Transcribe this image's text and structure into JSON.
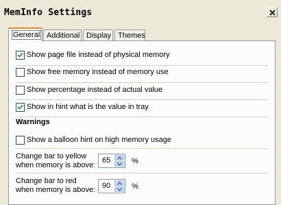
{
  "window": {
    "title": "MemInfo Settings"
  },
  "tabs": [
    {
      "label": "General",
      "active": true
    },
    {
      "label": "Additional",
      "active": false
    },
    {
      "label": "Display",
      "active": false
    },
    {
      "label": "Themes",
      "active": false
    }
  ],
  "options": [
    {
      "label": "Show page file instead of physical memory",
      "checked": true
    },
    {
      "label": "Show free memory instead of memory use",
      "checked": false
    },
    {
      "label": "Show percentage instead of actual value",
      "checked": false
    },
    {
      "label": "Show in hint what is the value in tray",
      "checked": true
    }
  ],
  "warnings": {
    "heading": "Warnings",
    "balloon": {
      "label": "Show a balloon hint on high memory usage",
      "checked": false
    },
    "yellow": {
      "label_line1": "Change bar to yellow",
      "label_line2": "when memory is above:",
      "value": "65",
      "unit": "%"
    },
    "red": {
      "label_line1": "Change bar to red",
      "label_line2": "when memory is above:",
      "value": "90",
      "unit": "%"
    }
  },
  "icons": {
    "close": "close-icon",
    "check": "check-icon",
    "spin_up": "arrow-up-icon",
    "spin_down": "arrow-down-icon"
  },
  "colors": {
    "active_tab_accent": "#E68B2C",
    "dialog_bg": "#ECE9D8",
    "checkbox_border": "#1C5180"
  }
}
